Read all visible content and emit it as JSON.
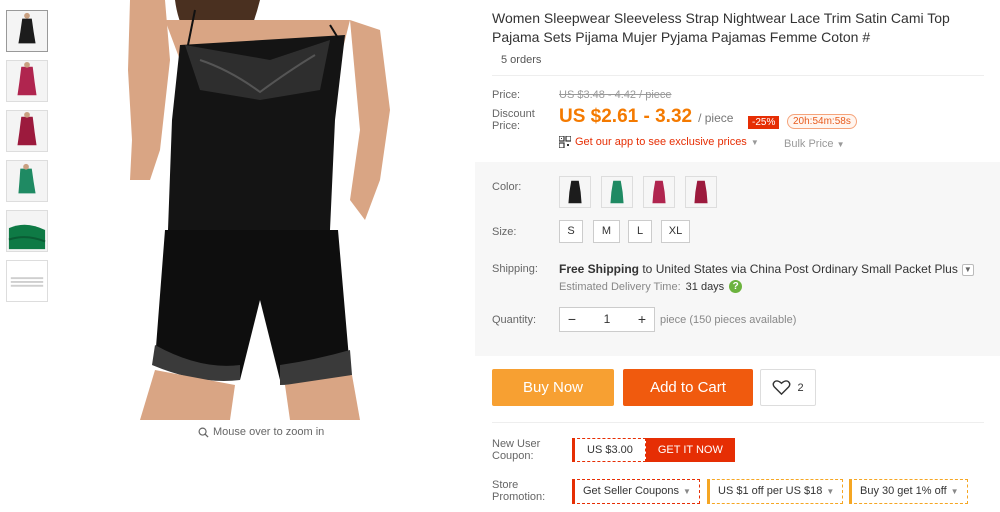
{
  "thumbnails": [
    {
      "name": "black",
      "color": "#1c1c1c",
      "active": true
    },
    {
      "name": "rose",
      "color": "#b0254f"
    },
    {
      "name": "wine",
      "color": "#9c1a3d"
    },
    {
      "name": "green",
      "color": "#1f8a63"
    },
    {
      "name": "green-folded",
      "color": "#0e7a45"
    },
    {
      "name": "size-chart",
      "color": "#cfcfcf"
    }
  ],
  "image": {
    "zoom_hint": "Mouse over to zoom in"
  },
  "product": {
    "title": "Women Sleepwear Sleeveless Strap Nightwear Lace Trim Satin Cami Top Pajama Sets Pijama Mujer Pyjama Pajamas Femme Coton #",
    "orders": "5 orders"
  },
  "price": {
    "label": "Price:",
    "original": "US $3.48 - 4.42 / piece",
    "discount_label_1": "Discount",
    "discount_label_2": "Price:",
    "current": "US $2.61 - 3.32",
    "unit": "/ piece",
    "discount_badge": "-25%",
    "countdown": "20h:54m:58s",
    "app_text": "Get our app to see exclusive prices",
    "bulk_text": "Bulk Price"
  },
  "options": {
    "color_label": "Color:",
    "colors": [
      "#1c1c1c",
      "#1f8a63",
      "#b0254f",
      "#9c1a3d"
    ],
    "size_label": "Size:",
    "sizes": [
      "S",
      "M",
      "L",
      "XL"
    ],
    "shipping_label": "Shipping:",
    "shipping_bold_1": "Free Shipping",
    "shipping_plain_1": " to ",
    "shipping_bold_2": "United States",
    "shipping_plain_2": " via ",
    "shipping_bold_3": "China Post Ordinary Small Packet Plus",
    "delivery_label": "Estimated Delivery Time:",
    "delivery_days": "31 days",
    "quantity_label": "Quantity:",
    "quantity_minus": "−",
    "quantity_value": "1",
    "quantity_plus": "+",
    "quantity_note": "piece (150 pieces available)"
  },
  "actions": {
    "buy_now": "Buy Now",
    "add_to_cart": "Add to Cart",
    "wishlist_count": "2"
  },
  "coupons": {
    "new_user_label_1": "New User",
    "new_user_label_2": "Coupon:",
    "coupon_value": "US $3.00",
    "coupon_cta": "GET IT NOW",
    "store_label_1": "Store",
    "store_label_2": "Promotion:",
    "promos": [
      "Get Seller Coupons",
      "US $1 off per US $18",
      "Buy 30 get 1% off"
    ]
  },
  "colors": {
    "accent_orange": "#f47a00",
    "cart_orange": "#f05a0e",
    "buy_orange": "#f7a032",
    "red": "#e62e04"
  }
}
